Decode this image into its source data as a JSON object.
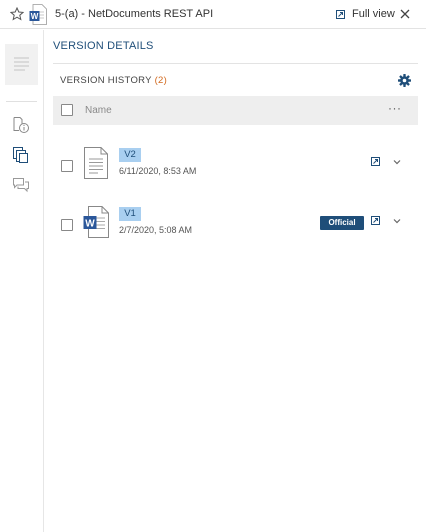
{
  "window": {
    "title": "5-(a) - NetDocuments REST API",
    "full_view_label": "Full view"
  },
  "panel": {
    "heading": "VERSION DETAILS",
    "version_history_label": "VERSION HISTORY",
    "version_count_text": "(2)",
    "column_name": "Name",
    "more_label": "···"
  },
  "versions": [
    {
      "label": "V2",
      "date": "6/11/2020, 8:53 AM",
      "file_type": "generic-document",
      "official": false
    },
    {
      "label": "V1",
      "date": "2/7/2020, 5:08 AM",
      "file_type": "word-document",
      "official": true,
      "official_label": "Official"
    }
  ],
  "colors": {
    "accent": "#1f4e79",
    "badge": "#a9cff0",
    "count": "#d2691e",
    "word_blue": "#2b579a"
  },
  "icons": [
    "star-icon",
    "word-document-icon",
    "open-external-icon",
    "close-icon",
    "document-preview-icon",
    "info-icon",
    "versions-icon",
    "comments-icon",
    "gear-icon",
    "chevron-down-icon"
  ]
}
